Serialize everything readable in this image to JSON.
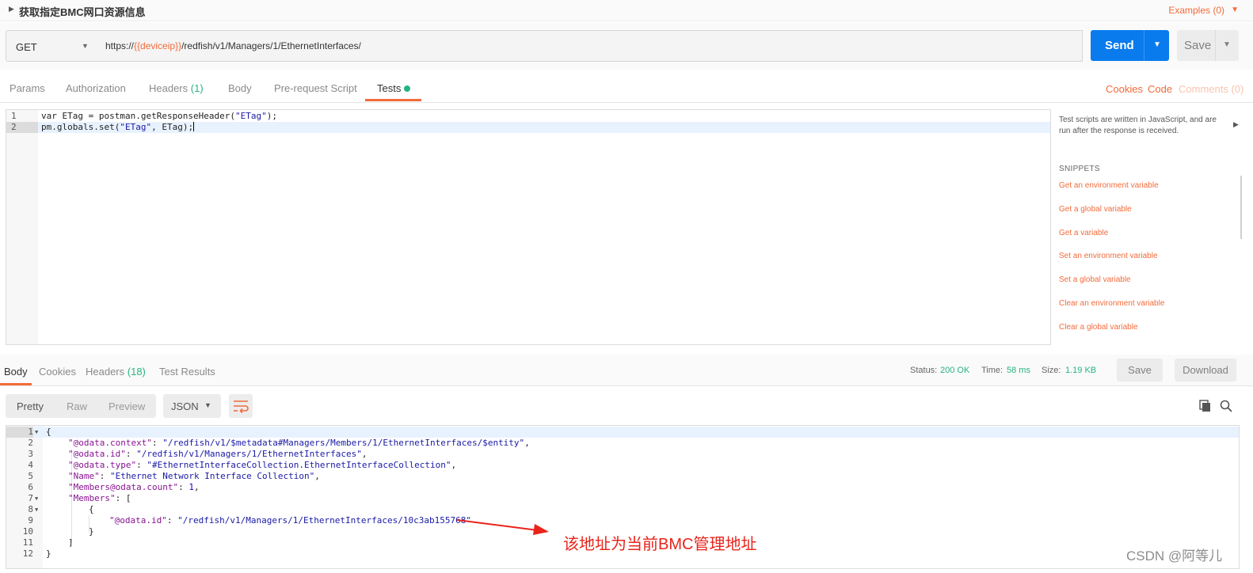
{
  "request": {
    "name": "获取指定BMC网口资源信息",
    "examples_label": "Examples (0)",
    "method": "GET",
    "url_prefix": "https://",
    "url_var": "{{deviceip}}",
    "url_suffix": "/redfish/v1/Managers/1/EthernetInterfaces/",
    "send_label": "Send",
    "save_label": "Save"
  },
  "request_tabs": {
    "params": "Params",
    "authorization": "Authorization",
    "headers": "Headers",
    "headers_count": "(1)",
    "body": "Body",
    "prerequest": "Pre-request Script",
    "tests": "Tests",
    "cookies": "Cookies",
    "code": "Code",
    "comments": "Comments (0)"
  },
  "editor": {
    "lines": [
      {
        "num": "1",
        "a": "var ETag = postman.getResponseHeader(",
        "s": "\"ETag\"",
        "b": ");"
      },
      {
        "num": "2",
        "a": "pm.globals.set(",
        "s": "\"ETag\"",
        "b": ", ETag);"
      }
    ]
  },
  "snippets": {
    "description": "Test scripts are written in JavaScript, and are run after the response is received.",
    "title": "SNIPPETS",
    "items": [
      "Get an environment variable",
      "Get a global variable",
      "Get a variable",
      "Set an environment variable",
      "Set a global variable",
      "Clear an environment variable",
      "Clear a global variable"
    ]
  },
  "response_tabs": {
    "body": "Body",
    "cookies": "Cookies",
    "headers": "Headers",
    "headers_count": "(18)",
    "test_results": "Test Results"
  },
  "response_status": {
    "status_label": "Status:",
    "status_value": "200 OK",
    "time_label": "Time:",
    "time_value": "58 ms",
    "size_label": "Size:",
    "size_value": "1.19 KB",
    "save_label": "Save",
    "download_label": "Download"
  },
  "response_toolbar": {
    "pretty": "Pretty",
    "raw": "Raw",
    "preview": "Preview",
    "format": "JSON"
  },
  "response_body": {
    "lines": [
      {
        "num": "1",
        "k": "",
        "v": "{",
        "fold": "▼"
      },
      {
        "num": "2",
        "k": "\"@odata.context\"",
        "v": "\"/redfish/v1/$metadata#Managers/Members/1/EthernetInterfaces/$entity\"",
        "tail": ","
      },
      {
        "num": "3",
        "k": "\"@odata.id\"",
        "v": "\"/redfish/v1/Managers/1/EthernetInterfaces\"",
        "tail": ","
      },
      {
        "num": "4",
        "k": "\"@odata.type\"",
        "v": "\"#EthernetInterfaceCollection.EthernetInterfaceCollection\"",
        "tail": ","
      },
      {
        "num": "5",
        "k": "\"Name\"",
        "v": "\"Ethernet Network Interface Collection\"",
        "tail": ","
      },
      {
        "num": "6",
        "k": "\"Members@odata.count\"",
        "v": "1",
        "tail": ","
      },
      {
        "num": "7",
        "k": "\"Members\"",
        "v": "[",
        "fold": "▼"
      },
      {
        "num": "8",
        "k": "",
        "v": "{",
        "fold": "▼"
      },
      {
        "num": "9",
        "k": "\"@odata.id\"",
        "v": "\"/redfish/v1/Managers/1/EthernetInterfaces/10c3ab155768\""
      },
      {
        "num": "10",
        "k": "",
        "v": "}"
      },
      {
        "num": "11",
        "k": "",
        "v": "]"
      },
      {
        "num": "12",
        "k": "",
        "v": "}"
      }
    ]
  },
  "annotation": {
    "text": "该地址为当前BMC管理地址",
    "color": "#e8241b"
  },
  "watermark": "CSDN @阿等儿",
  "colors": {
    "accent": "#f26b3a",
    "send": "#097bed",
    "success": "#26b47f"
  }
}
